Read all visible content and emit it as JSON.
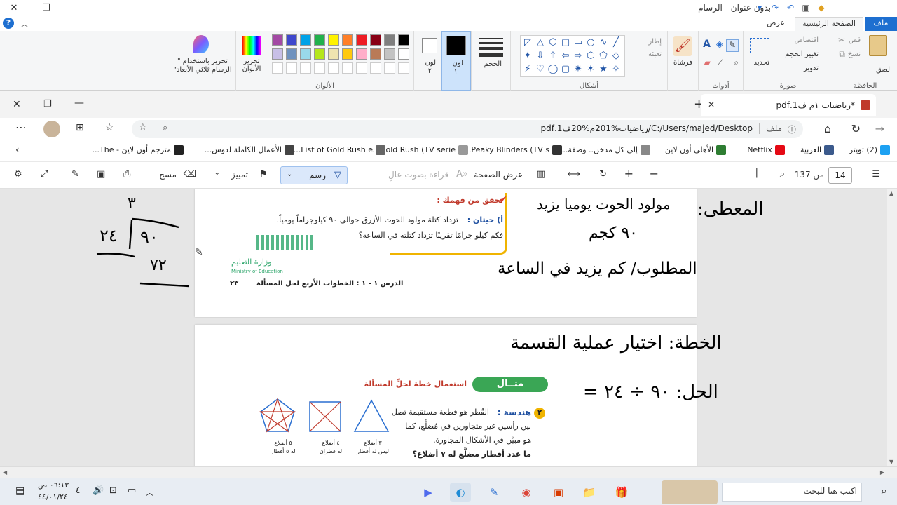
{
  "paint": {
    "title": "بدون عنوان - الرسام",
    "tabs": {
      "file": "ملف",
      "home": "الصفحة الرئيسية",
      "view": "عرض"
    },
    "clipboard": {
      "paste": "لصق",
      "cut": "قص",
      "copy": "نسخ",
      "label": "الحافظة"
    },
    "image": {
      "select": "تحديد",
      "crop": "اقتصاص",
      "resize": "تغيير الحجم",
      "rotate": "تدوير",
      "label": "صورة"
    },
    "tools": {
      "label": "أدوات"
    },
    "brushes": {
      "label": "فرشاة"
    },
    "shapes": {
      "outline": "إطار",
      "fill": "تعبئة",
      "label": "أشكال"
    },
    "size": {
      "label": "الحجم"
    },
    "color1": {
      "label": "لون",
      "num": "١"
    },
    "color2": {
      "label": "لون",
      "num": "٢"
    },
    "colors": {
      "label": "الألوان",
      "edit": "تحرير الألوان"
    },
    "paint3d": {
      "label": "تحرير باستخدام \" الرسام ثلاثي الأبعاد\""
    },
    "palette_row1": [
      "#000000",
      "#7f7f7f",
      "#880015",
      "#ed1c24",
      "#ff7f27",
      "#fff200",
      "#22b14c",
      "#00a2e8",
      "#3f48cc",
      "#a349a4"
    ],
    "palette_row2": [
      "#ffffff",
      "#c3c3c3",
      "#b97a57",
      "#ffaec9",
      "#ffc90e",
      "#efe4b0",
      "#b5e61d",
      "#99d9ea",
      "#7092be",
      "#c8bfe7"
    ]
  },
  "edge": {
    "tab_title": "*رياضيات ١م ف1.pdf",
    "address_prefix": "ملف",
    "address": "C:/Users/majed/Desktop/رياضيات%201م%20ف1.pdf",
    "favorites": [
      "(2) تويتر",
      "العربية",
      "Netflix",
      "الأهلي أون لاين",
      "إلى كل مدخن.. وصفة...",
      "Peaky Blinders (TV s...",
      "Gold Rush (TV serie...",
      "List of Gold Rush e...",
      "الأعمال الكاملة لدوس...",
      "مترجم أون لاين - The..."
    ],
    "pdf_toolbar": {
      "page_current": "14",
      "page_total": "من 137",
      "page_view": "عرض الصفحة",
      "read_aloud": "قراءة بصوت عالٍ",
      "draw": "رسم",
      "highlight": "تمييز",
      "erase": "مسح"
    }
  },
  "page1": {
    "check_title": "تحقق من فهمك :",
    "item_label": "أ) حيتان :",
    "item_text": "تزداد كتلة مولود الحوت الأزرق حوالي ٩٠ كيلوجراماً يومياً.",
    "item_question": "فكم كيلو جرامًا تقريبًا تزداد كتلته في الساعة؟",
    "ministry_ar": "وزارة التعليم",
    "ministry_en": "Ministry of Education",
    "footer": "الدرس ١ - ١ : الخطوات الأربع لحل المسألة",
    "page_num": "٢٣"
  },
  "page2": {
    "example_badge": "مثــال",
    "example_title": "استعمال خطة لحلِّ المسألة",
    "q_num": "٢",
    "q_label": "هندسة :",
    "q_text1": "القُطر هو قطعة مستقيمة تصل",
    "q_text2": "بين رأسين غير متجاورين في مُضلَّع، كما",
    "q_text3": "هو مبيَّن في الأشكال المجاورة.",
    "q_text4": "ما عدد أقطار مضلَّع له ٧ أضلاع؟",
    "shapes": [
      {
        "l1": "٣ أضلاع",
        "l2": "ليس له أقطار"
      },
      {
        "l1": "٤ أضلاع",
        "l2": "له قطران"
      },
      {
        "l1": "٥ أضلاع",
        "l2": "له ٥ أقطار"
      }
    ]
  },
  "handwriting": {
    "given": "المعطى:",
    "given_text": "مولود الحوت يوميا يزيد",
    "given_value": "٩٠ كجم",
    "required": "المطلوب/ كم يزيد في الساعة",
    "plan": "الخطة: اختيار عملية القسمة",
    "solution": "الحل: ٩٠ ÷ ٢٤ =",
    "div_quotient": "٣",
    "div_divisor": "٢٤",
    "div_dividend": "٩٠",
    "div_result": "٧٢"
  },
  "taskbar": {
    "search_placeholder": "اكتب هنا للبحث",
    "time": "٠٦:١٣ ص",
    "date": "٤٤/٠١/٢٤",
    "notif_count": "٤"
  }
}
